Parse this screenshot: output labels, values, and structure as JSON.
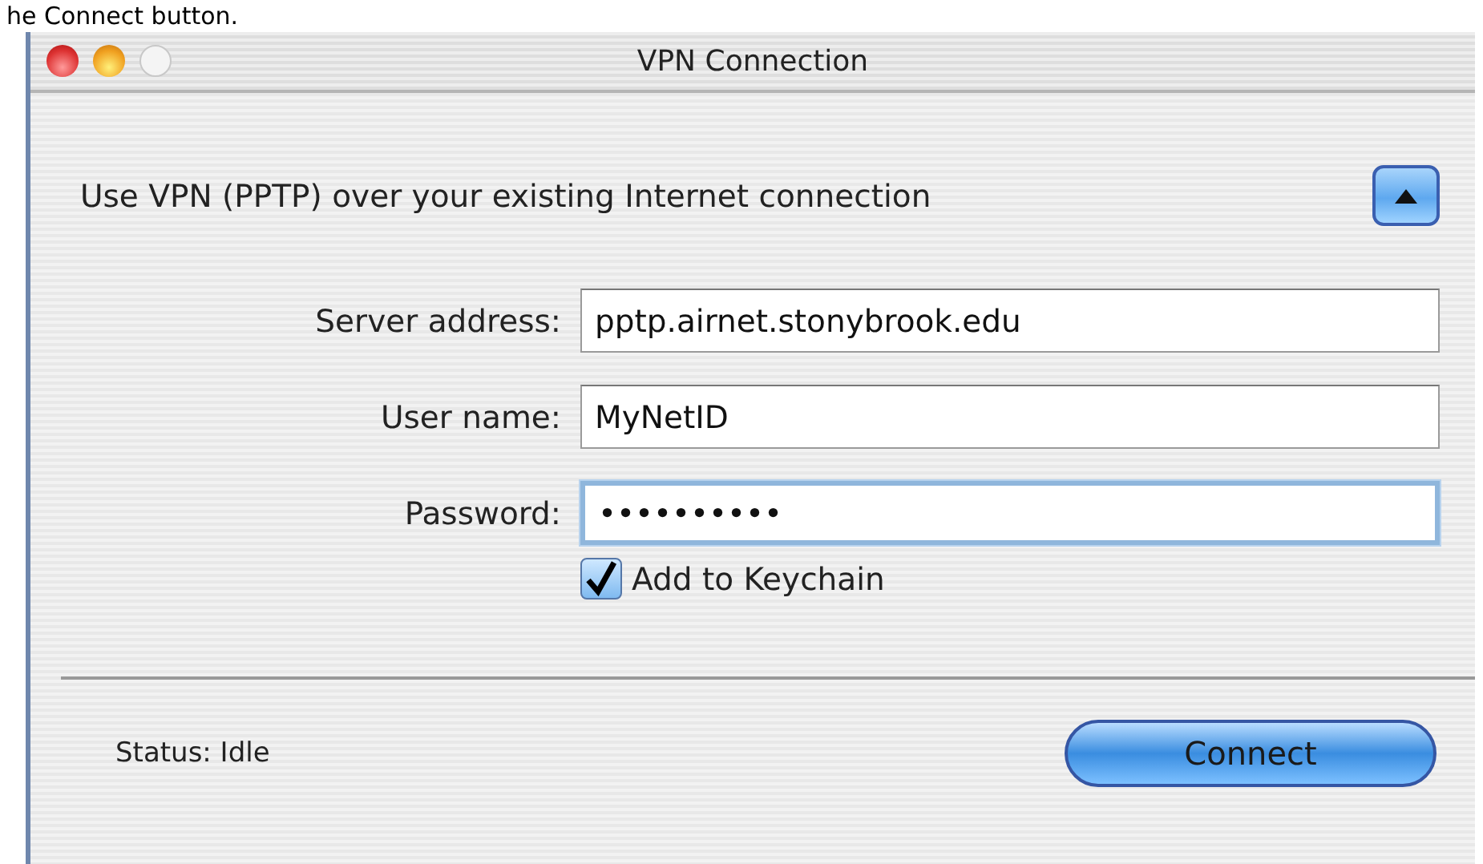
{
  "caption": "he Connect button.",
  "window": {
    "title": "VPN Connection"
  },
  "section": {
    "heading": "Use VPN (PPTP) over your existing Internet connection",
    "expanded": true
  },
  "fields": [
    {
      "label": "Server address:",
      "value": "pptp.airnet.stonybrook.edu",
      "focused": false
    },
    {
      "label": "User name:",
      "value": "MyNetID",
      "focused": false
    },
    {
      "label": "Password:",
      "value": "••••••••••",
      "focused": true
    }
  ],
  "keychain": {
    "label": "Add to Keychain",
    "checked": true
  },
  "status": {
    "label": "Status:",
    "value": "Idle"
  },
  "connect_button": "Connect"
}
